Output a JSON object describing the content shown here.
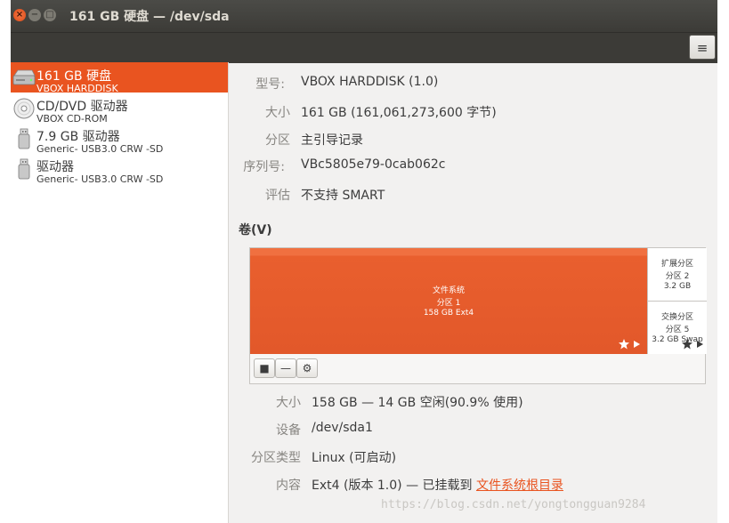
{
  "window": {
    "title": "161 GB 硬盘 — /dev/sda"
  },
  "header": {
    "menu_icon": "hamburger-icon",
    "menu_glyph": "≡"
  },
  "drives": [
    {
      "name": "161 GB 硬盘",
      "sub": "VBOX HARDDISK",
      "icon": "harddisk-icon",
      "selected": true
    },
    {
      "name": "CD/DVD 驱动器",
      "sub": "VBOX CD-ROM",
      "icon": "optical-disc-icon"
    },
    {
      "name": "7.9 GB 驱动器",
      "sub": "Generic- USB3.0 CRW   -SD",
      "icon": "usb-drive-icon"
    },
    {
      "name": "驱动器",
      "sub": "Generic- USB3.0 CRW   -SD",
      "icon": "usb-drive-icon"
    }
  ],
  "disk_info": {
    "model_label": "型号:",
    "model_value": "VBOX HARDDISK (1.0)",
    "size_label": "大小",
    "size_value": "161 GB (161,061,273,600 字节)",
    "partition_label": "分区",
    "partition_value": "主引导记录",
    "serial_label": "序列号:",
    "serial_value": "VBc5805e79-0cab062c",
    "assessment_label": "评估",
    "assessment_value": "不支持 SMART"
  },
  "volumes": {
    "section_label": "卷(V)",
    "main": {
      "line1": "文件系统",
      "line2": "分区 1",
      "line3": "158 GB Ext4"
    },
    "extended": {
      "line1": "扩展分区",
      "line2": "分区 2",
      "line3": "3.2 GB"
    },
    "swap": {
      "line1": "交换分区",
      "line2": "分区 5",
      "line3": "3.2 GB Swap"
    },
    "toolbar": {
      "stop_glyph": "■",
      "minus_glyph": "—",
      "gear_glyph": "⚙"
    }
  },
  "volume_info": {
    "size_label": "大小",
    "size_value": "158 GB — 14 GB 空闲(90.9% 使用)",
    "device_label": "设备",
    "device_value": "/dev/sda1",
    "type_label": "分区类型",
    "type_value": "Linux (可启动)",
    "contents_label": "内容",
    "contents_value": "Ext4 (版本 1.0) — 已挂载到 ",
    "contents_link": "文件系统根目录"
  },
  "watermark": "https://blog.csdn.net/yongtongguan9284",
  "colors": {
    "accent": "#e95420",
    "titlebar": "#3c3b37",
    "window_bg": "#f2f1f0"
  }
}
